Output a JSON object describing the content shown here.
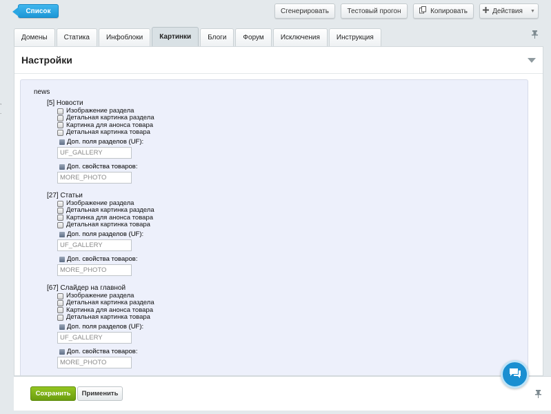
{
  "toolbar": {
    "list_label": "Список",
    "generate_label": "Сгенерировать",
    "test_run_label": "Тестовый прогон",
    "copy_label": "Копировать",
    "actions_label": "Действия"
  },
  "tabs": [
    {
      "label": "Домены"
    },
    {
      "label": "Статика"
    },
    {
      "label": "Инфоблоки"
    },
    {
      "label": "Картинки",
      "active": true
    },
    {
      "label": "Блоги"
    },
    {
      "label": "Форум"
    },
    {
      "label": "Исключения"
    },
    {
      "label": "Инструкция"
    }
  ],
  "panel": {
    "title": "Настройки",
    "site_name": "news"
  },
  "iblocks": [
    {
      "title": "[5] Новости",
      "checkboxes": [
        "Изображение раздела",
        "Детальная картинка раздела",
        "Картинка для анонса товара",
        "Детальная картинка товара"
      ],
      "section_uf_label": "Доп. поля разделов (UF):",
      "section_uf_value": "UF_GALLERY",
      "product_props_label": "Доп. свойства товаров:",
      "product_props_value": "MORE_PHOTO"
    },
    {
      "title": "[27] Статьи",
      "checkboxes": [
        "Изображение раздела",
        "Детальная картинка раздела",
        "Картинка для анонса товара",
        "Детальная картинка товара"
      ],
      "section_uf_label": "Доп. поля разделов (UF):",
      "section_uf_value": "UF_GALLERY",
      "product_props_label": "Доп. свойства товаров:",
      "product_props_value": "MORE_PHOTO"
    },
    {
      "title": "[67] Слайдер на главной",
      "checkboxes": [
        "Изображение раздела",
        "Детальная картинка раздела",
        "Картинка для анонса товара",
        "Детальная картинка товара"
      ],
      "section_uf_label": "Доп. поля разделов (UF):",
      "section_uf_value": "UF_GALLERY",
      "product_props_label": "Доп. свойства товаров:",
      "product_props_value": "MORE_PHOTO"
    }
  ],
  "footer": {
    "save_label": "Сохранить",
    "apply_label": "Применить"
  },
  "edge_marks": [
    ",",
    "."
  ],
  "icons": {
    "copy": "copy-icon",
    "actions": "plus-icon",
    "pin": "pin-icon",
    "chat": "chat-icon"
  },
  "colors": {
    "primary_button": "#1d97d6",
    "save_button": "#7aad14",
    "content_bg": "#edf0fb",
    "chat_button": "#1a8fd1"
  }
}
